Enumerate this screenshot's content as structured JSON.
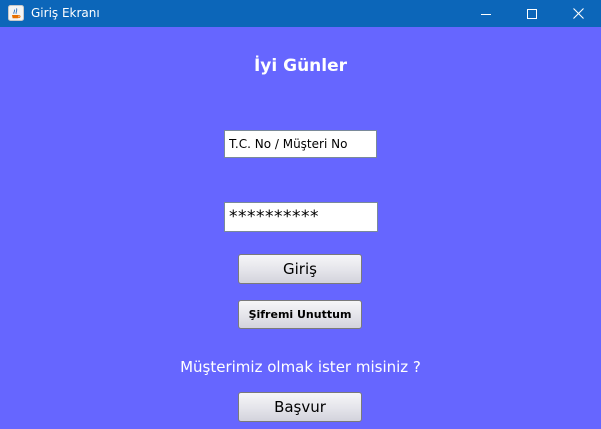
{
  "window": {
    "title": "Giriş Ekranı",
    "icon": "java-cup-icon",
    "controls": {
      "minimize": "minimize-icon",
      "maximize": "maximize-icon",
      "close": "close-icon"
    }
  },
  "form": {
    "heading": "İyi Günler",
    "id_field": {
      "value": "T.C. No / Müşteri No"
    },
    "password_field": {
      "value": "**********"
    },
    "login_button": "Giriş",
    "forgot_button": "Şifremi Unuttum",
    "question": "Müşterimiz olmak ister misiniz ?",
    "apply_button": "Başvur"
  },
  "colors": {
    "background": "#6666ff",
    "titlebar": "#0c66b9",
    "text_light": "#ffffff"
  }
}
